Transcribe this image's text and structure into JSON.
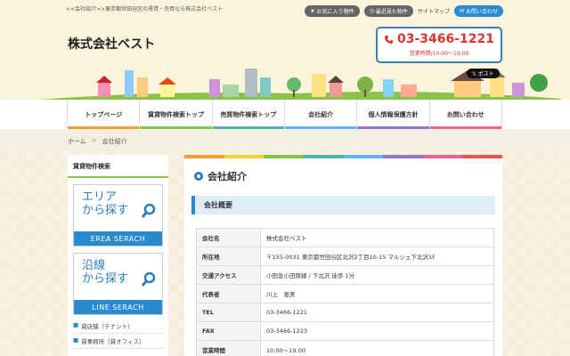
{
  "header": {
    "tagline": "<<会社紹介>>東京都世田谷区の賃貸・売買なら株式会社ベスト",
    "links": {
      "favorites": "お気に入り物件",
      "recent": "最近見た物件",
      "sitemap": "サイトマップ",
      "contact": "お問い合わせ"
    },
    "logo": "株式会社ベスト",
    "phone": "03-3466-1221",
    "hours": "営業時間/10:00～19:00",
    "x_post": "ポスト"
  },
  "nav": {
    "items": [
      {
        "label": "トップページ",
        "color": "#f0a030"
      },
      {
        "label": "賃貸物件検索トップ",
        "color": "#8bc34a"
      },
      {
        "label": "売買物件検索トップ",
        "color": "#4db6ac"
      },
      {
        "label": "会社紹介",
        "color": "#64b5f6"
      },
      {
        "label": "個人情報保護方針",
        "color": "#9575cd"
      },
      {
        "label": "お問い合わせ",
        "color": "#f06292"
      }
    ]
  },
  "breadcrumb": {
    "home": "ホーム",
    "sep": ">",
    "current": "会社紹介"
  },
  "sidebar": {
    "title": "賃貸物件検索",
    "area": {
      "line1": "エリア",
      "line2": "から探す",
      "band": "EREA SERACH"
    },
    "line": {
      "line1": "沿線",
      "line2": "から探す",
      "band": "LINE SERACH"
    },
    "links": [
      "貸店舗（テナント）",
      "貸事務所（貸オフィス）"
    ]
  },
  "main": {
    "title": "会社紹介",
    "section": "会社概要",
    "rows": [
      {
        "key": "会社名",
        "value": "株式会社ベスト"
      },
      {
        "key": "所在地",
        "value": "〒155-0031 東京都世田谷区北沢2丁目10-15 マルシェ下北沢1F"
      },
      {
        "key": "交通アクセス",
        "value": "小田急小田原線 / 下北沢 徒歩 1分"
      },
      {
        "key": "代表者",
        "value": "川上　恵美"
      },
      {
        "key": "TEL",
        "value": "03-3466-1221"
      },
      {
        "key": "FAX",
        "value": "03-3466-1223"
      },
      {
        "key": "営業時間",
        "value": "10:00～19:00"
      }
    ]
  },
  "colors": {
    "accent": "#2a8ad0",
    "phone": "#dd3333",
    "rainbow": [
      "#f0a030",
      "#f4d03f",
      "#8bc34a",
      "#4db6ac",
      "#64b5f6",
      "#9575cd",
      "#f06292",
      "#ef5350"
    ]
  }
}
